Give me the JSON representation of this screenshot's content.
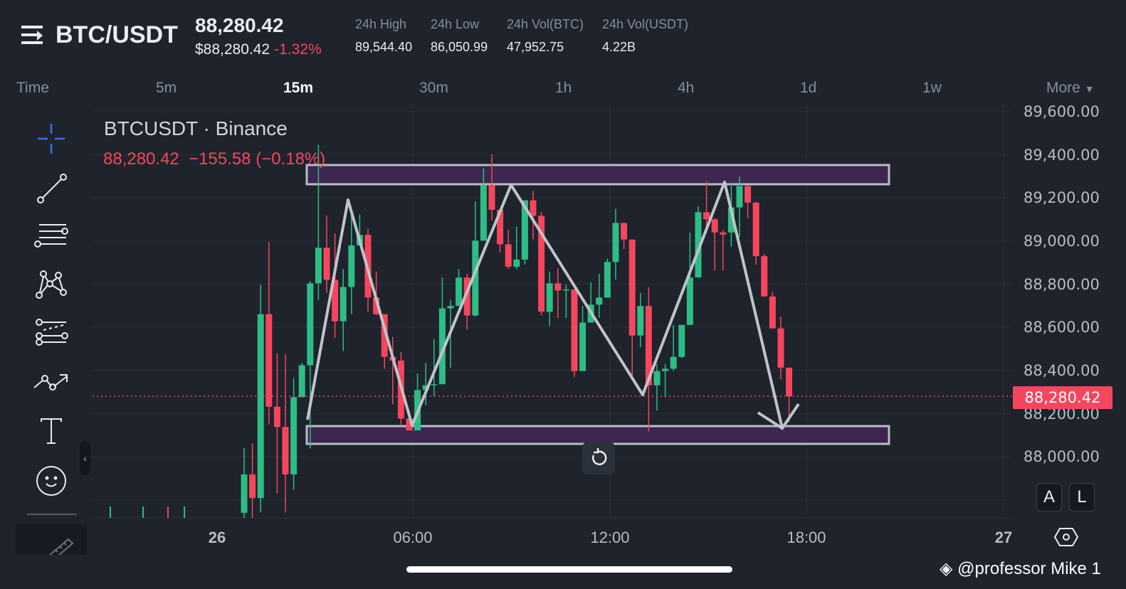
{
  "header": {
    "pair": "BTC/USDT",
    "last_price": "88,280.42",
    "usd_price": "$88,280.42",
    "change_pct": "-1.32%",
    "stats": [
      {
        "label": "24h High",
        "value": "89,544.40"
      },
      {
        "label": "24h Low",
        "value": "86,050.99"
      },
      {
        "label": "24h Vol(BTC)",
        "value": "47,952.75"
      },
      {
        "label": "24h Vol(USDT)",
        "value": "4.22B"
      }
    ]
  },
  "timeframes": {
    "time_label": "Time",
    "items": [
      "5m",
      "15m",
      "30m",
      "1h",
      "4h",
      "1d",
      "1w"
    ],
    "active": "15m",
    "more": "More"
  },
  "chart": {
    "symbol_legend": "BTCUSDT · Binance",
    "ohlc_line": "88,280.42  −155.58 (−0.18%)",
    "current_price_tag": "88,280.42",
    "y_ticks": [
      "89,600.00",
      "89,400.00",
      "89,200.00",
      "89,000.00",
      "88,800.00",
      "88,600.00",
      "88,400.00",
      "88,200.00",
      "88,000.00"
    ],
    "x_ticks": [
      "26",
      "06:00",
      "12:00",
      "18:00",
      "27"
    ],
    "auto_button": "A",
    "log_button": "L"
  },
  "watermark": "@professor Mike 1",
  "colors": {
    "up": "#2ebd85",
    "down": "#f6465d",
    "zone": "#3d2650",
    "accent": "#3a6ff7"
  },
  "chart_data": {
    "type": "candlestick",
    "interval": "15m",
    "ylim": [
      87700,
      89650
    ],
    "current_price": 88280.42,
    "candles": [
      [
        87740,
        87918,
        88040,
        87700
      ],
      [
        87918,
        87808,
        88061,
        87700
      ],
      [
        87808,
        88661,
        88798,
        87742
      ],
      [
        88661,
        88232,
        88996,
        88150
      ],
      [
        88232,
        88138,
        88479,
        87830
      ],
      [
        88138,
        87918,
        88474,
        87742
      ],
      [
        87918,
        88276,
        88364,
        87847
      ],
      [
        88276,
        88424,
        88435,
        88276
      ],
      [
        88424,
        88804,
        88815,
        88039
      ],
      [
        88804,
        88969,
        89447,
        88727
      ],
      [
        88969,
        88820,
        89117,
        88760
      ],
      [
        88820,
        88628,
        89035,
        88551
      ],
      [
        88628,
        88787,
        88870,
        88490
      ],
      [
        88787,
        88980,
        89123,
        88661
      ],
      [
        88980,
        89029,
        89123,
        88980
      ],
      [
        89029,
        88738,
        89057,
        88672
      ],
      [
        88738,
        88661,
        88859,
        88655
      ],
      [
        88661,
        88463,
        88661,
        88408
      ],
      [
        88463,
        88446,
        88556,
        88243
      ],
      [
        88446,
        88177,
        88485,
        88144
      ],
      [
        88177,
        88122,
        88215,
        88122
      ],
      [
        88122,
        88309,
        88386,
        88122
      ],
      [
        88309,
        88331,
        88435,
        88238
      ],
      [
        88331,
        88336,
        88545,
        88281
      ],
      [
        88336,
        88688,
        88831,
        88336
      ],
      [
        88688,
        88699,
        88727,
        88413
      ],
      [
        88699,
        88831,
        88870,
        88699
      ],
      [
        88831,
        88655,
        88848,
        88589
      ],
      [
        88655,
        89002,
        89183,
        88650
      ],
      [
        89002,
        89260,
        89337,
        89002
      ],
      [
        89260,
        89145,
        89403,
        89095
      ],
      [
        89145,
        88985,
        89145,
        88947
      ],
      [
        88985,
        88881,
        89051,
        88870
      ],
      [
        88881,
        88914,
        89067,
        88870
      ],
      [
        88914,
        89189,
        89189,
        88892
      ],
      [
        89189,
        89117,
        89233,
        89007
      ],
      [
        89117,
        88672,
        89134,
        88655
      ],
      [
        88672,
        88804,
        88859,
        88606
      ],
      [
        88804,
        88771,
        88875,
        88644
      ],
      [
        88771,
        88776,
        88798,
        88644
      ],
      [
        88776,
        88397,
        88776,
        88369
      ],
      [
        88397,
        88622,
        88699,
        88397
      ],
      [
        88622,
        88705,
        88809,
        88622
      ],
      [
        88705,
        88738,
        88848,
        88644
      ],
      [
        88738,
        88903,
        88919,
        88738
      ],
      [
        88903,
        89084,
        89150,
        88820
      ],
      [
        89084,
        89007,
        89084,
        88963
      ],
      [
        89007,
        88562,
        89007,
        88375
      ],
      [
        88562,
        88699,
        88760,
        88507
      ],
      [
        88699,
        88331,
        88787,
        88117
      ],
      [
        88331,
        88397,
        88430,
        88215
      ],
      [
        88397,
        88408,
        88430,
        88276
      ],
      [
        88408,
        88463,
        88611,
        88397
      ],
      [
        88463,
        88611,
        88611,
        88457
      ],
      [
        88611,
        88831,
        89040,
        88611
      ],
      [
        88831,
        89134,
        89161,
        88831
      ],
      [
        89134,
        89101,
        89277,
        89035
      ],
      [
        89101,
        89040,
        89106,
        88864
      ],
      [
        89040,
        89030,
        89051,
        88864
      ],
      [
        89040,
        89156,
        89271,
        88974
      ],
      [
        89156,
        89255,
        89299,
        89018
      ],
      [
        89255,
        89178,
        89260,
        89106
      ],
      [
        89178,
        88930,
        89183,
        88892
      ],
      [
        88930,
        88743,
        88941,
        88743
      ],
      [
        88743,
        88595,
        88765,
        88595
      ],
      [
        88595,
        88413,
        88650,
        88358
      ],
      [
        88413,
        88280,
        88413,
        88160
      ]
    ]
  }
}
